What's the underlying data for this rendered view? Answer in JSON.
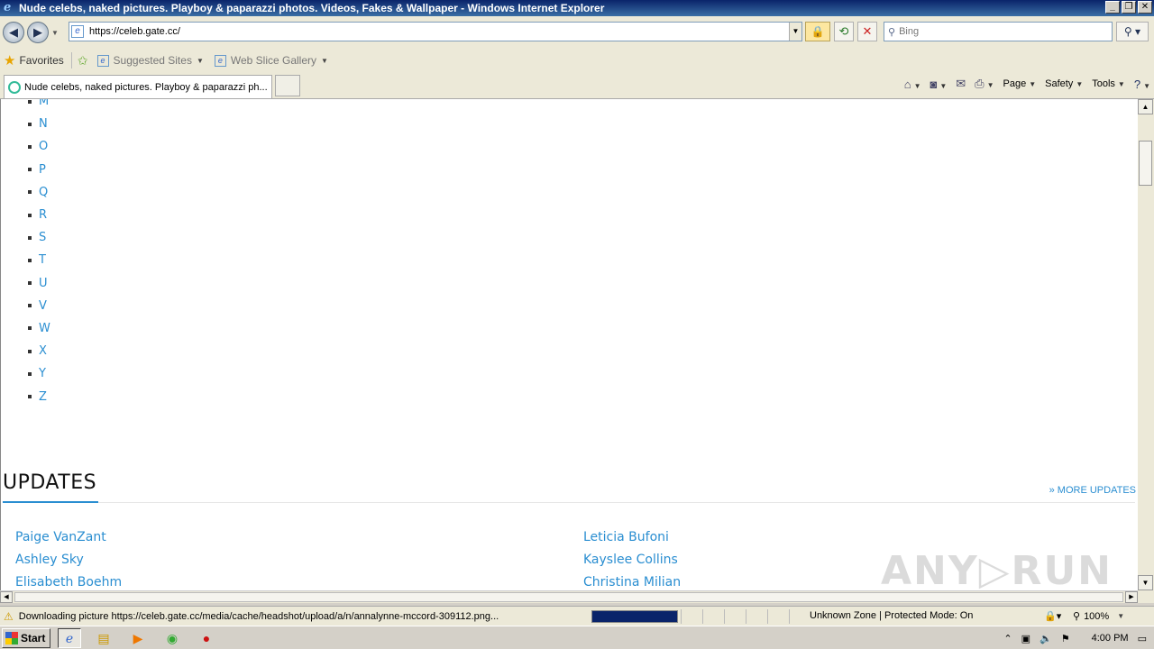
{
  "window": {
    "title": "Nude celebs, naked pictures. Playboy & paparazzi photos. Videos, Fakes & Wallpaper - Windows Internet Explorer",
    "minimize": "_",
    "restore": "❐",
    "close": "✕"
  },
  "nav": {
    "back_icon": "◀",
    "forward_icon": "▶",
    "address": "https://celeb.gate.cc/",
    "search_placeholder": "Bing",
    "lock_icon": "🔒",
    "refresh_icon": "⟲",
    "stop_icon": "✕",
    "search_btn": "⚲ ▾"
  },
  "favorites": {
    "label": "Favorites",
    "items": [
      {
        "label": "Suggested Sites"
      },
      {
        "label": "Web Slice Gallery"
      }
    ]
  },
  "tab": {
    "label": "Nude celebs, naked pictures. Playboy & paparazzi ph..."
  },
  "commandbar": {
    "page": "Page",
    "safety": "Safety",
    "tools": "Tools"
  },
  "page": {
    "letters": [
      "M",
      "N",
      "O",
      "P",
      "Q",
      "R",
      "S",
      "T",
      "U",
      "V",
      "W",
      "X",
      "Y",
      "Z"
    ],
    "updates_title": "UPDATES",
    "more_updates": "» MORE UPDATES",
    "updates_left": [
      "Paige VanZant",
      "Ashley Sky",
      "Elisabeth Boehm"
    ],
    "updates_right": [
      "Leticia Bufoni",
      "Kayslee Collins",
      "Christina Milian"
    ],
    "watermark": "ANY▷RUN"
  },
  "status": {
    "text": "Downloading picture https://celeb.gate.cc/media/cache/headshot/upload/a/n/annalynne-mccord-309112.png...",
    "progress": 1.0,
    "zone": "Unknown Zone | Protected Mode: On",
    "zoom": "100%"
  },
  "taskbar": {
    "start": "Start",
    "clock": "4:00 PM"
  }
}
